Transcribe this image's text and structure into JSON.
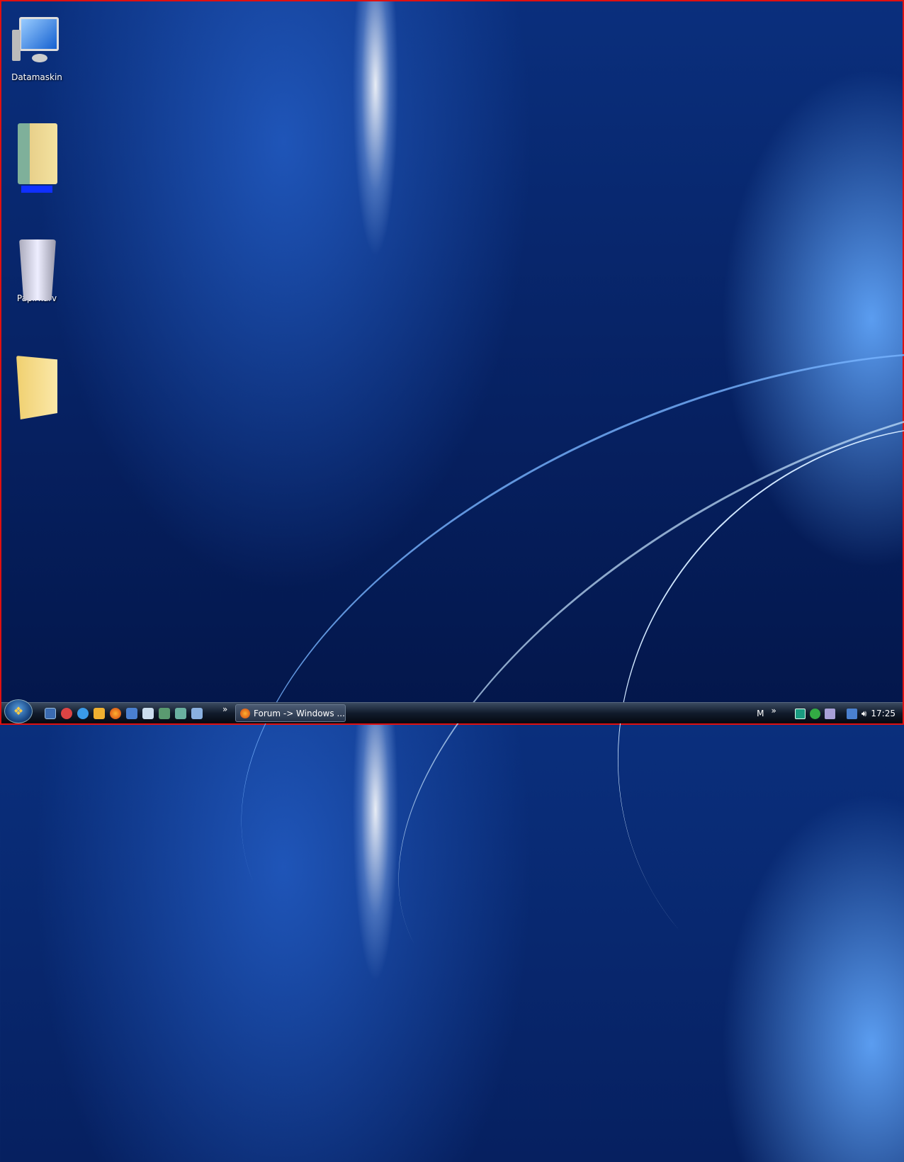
{
  "desktop": {
    "icons": [
      {
        "label": "Datamaskin",
        "icon": "computer-icon"
      },
      {
        "label": "",
        "icon": "user-folder-icon"
      },
      {
        "label": "Papirkurv",
        "icon": "recycle-bin-icon"
      },
      {
        "label": "",
        "icon": "folder-icon"
      }
    ]
  },
  "taskbar": {
    "quick_launch": [
      "show-desktop-icon",
      "paint-icon",
      "internet-explorer-icon",
      "messenger-icon",
      "firefox-icon",
      "remote-desktop-icon",
      "notepad-icon",
      "contacts-icon",
      "books-icon",
      "network-icon"
    ],
    "overflow": "»",
    "task_button": "Forum -> Windows ...",
    "language": "M",
    "tray_overflow": "»",
    "clock": "17:25"
  }
}
